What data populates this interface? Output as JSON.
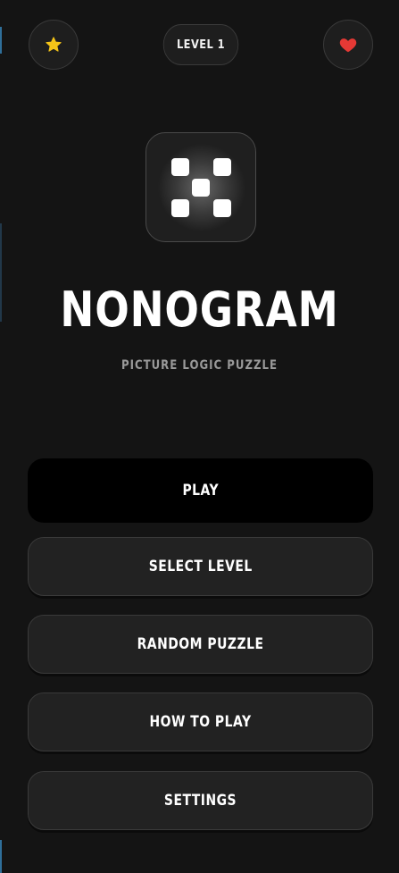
{
  "header": {
    "favorites_icon": "star-icon",
    "level_label": "LEVEL 1",
    "lives_icon": "heart-icon"
  },
  "logo": {
    "icon": "dice-five-icon"
  },
  "title": "NONOGRAM",
  "subtitle": "PICTURE LOGIC PUZZLE",
  "menu": {
    "play": "PLAY",
    "select_level": "SELECT LEVEL",
    "random_puzzle": "RANDOM PUZZLE",
    "how_to_play": "HOW TO PLAY",
    "settings": "SETTINGS"
  },
  "colors": {
    "background": "#141414",
    "star": "#f5c518",
    "heart": "#e53935",
    "primary_button": "#000000",
    "secondary_button": "#222222",
    "subtitle": "#9a9a9a"
  }
}
